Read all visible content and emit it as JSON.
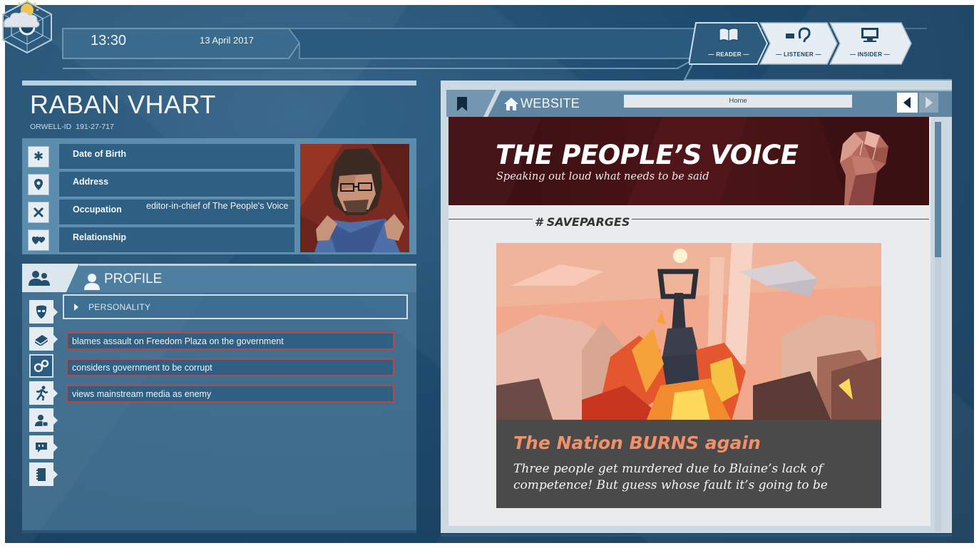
{
  "header": {
    "time": "13:30",
    "date": "13 April 2017",
    "weather_icon": "partly-cloudy-icon",
    "modes": [
      {
        "label": "READER",
        "icon": "book-icon",
        "active": true
      },
      {
        "label": "LISTENER",
        "icon": "ear-icon",
        "active": false
      },
      {
        "label": "INSIDER",
        "icon": "computer-icon",
        "active": false
      }
    ]
  },
  "person": {
    "name": "RABAN VHART",
    "orwell_id_label": "ORWELL-ID",
    "orwell_id": "191-27-717",
    "fields": [
      {
        "label": "Date of Birth",
        "value": "",
        "icon": "asterisk-icon"
      },
      {
        "label": "Address",
        "value": "",
        "icon": "location-pin-icon"
      },
      {
        "label": "Occupation",
        "value": "editor-in-chief of The People's Voice",
        "icon": "tools-icon"
      },
      {
        "label": "Relationship",
        "value": "",
        "icon": "hearts-icon"
      }
    ]
  },
  "profile": {
    "title": "PROFILE",
    "section": "PERSONALITY",
    "traits": [
      "blames assault on Freedom Plaza on the government",
      "considers government to be corrupt",
      "views mainstream media as enemy"
    ],
    "side_icons": [
      "mask-icon",
      "book-stack-icon",
      "gears-icon",
      "running-icon",
      "person-card-icon",
      "speech-bubble-icon",
      "notebook-icon"
    ]
  },
  "browser": {
    "tab_label": "WEBSITE",
    "url": "Home"
  },
  "website": {
    "title": "THE PEOPLE’S VOICE",
    "subtitle": "Speaking out loud what needs to be said",
    "hashtag": "# SAVEPARGES",
    "headline": "The Nation BURNS again",
    "body": "Three people get murdered due to Blaine’s lack of competence! But guess whose fault it’s going to be"
  },
  "colors": {
    "background": "#1e4a6d",
    "panel": "#5d8dac",
    "cell": "#2f5f82",
    "trait_border": "#b8474a",
    "banner": "#4a1416",
    "headline": "#f2906a"
  }
}
